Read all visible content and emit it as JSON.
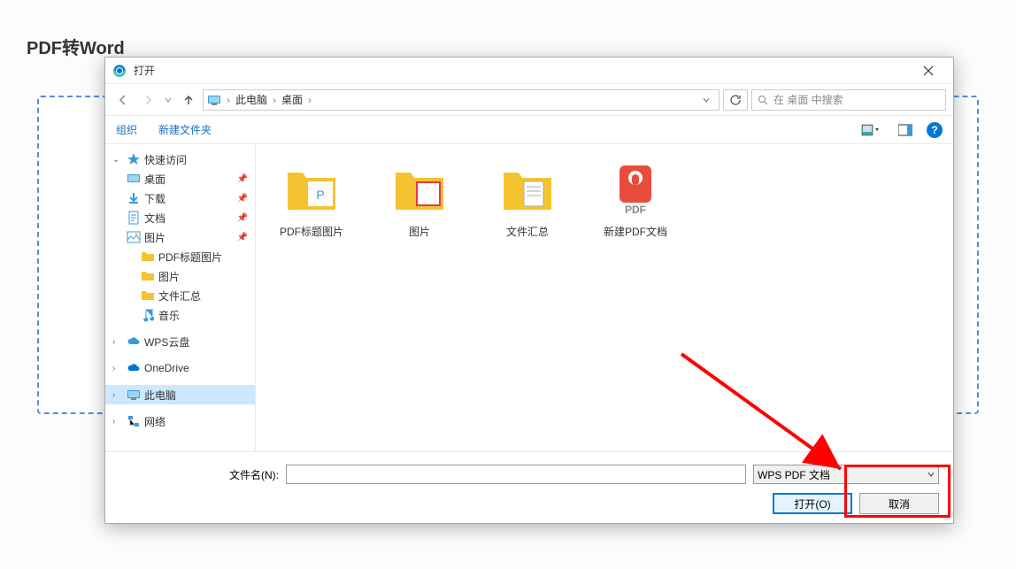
{
  "page": {
    "title": "PDF转Word"
  },
  "dialog": {
    "title": "打开",
    "nav": {
      "crumb1": "此电脑",
      "crumb2": "桌面",
      "search_placeholder": "在 桌面 中搜索"
    },
    "toolbar": {
      "organize": "组织",
      "new_folder": "新建文件夹"
    },
    "sidebar": {
      "quick_access": "快速访问",
      "desktop": "桌面",
      "downloads": "下载",
      "documents": "文档",
      "pictures": "图片",
      "pdf_title_pics": "PDF标题图片",
      "pics": "图片",
      "file_summary": "文件汇总",
      "music": "音乐",
      "wps_cloud": "WPS云盘",
      "onedrive": "OneDrive",
      "this_pc": "此电脑",
      "network": "网络"
    },
    "files": {
      "item1": "PDF标题图片",
      "item2": "图片",
      "item3": "文件汇总",
      "item4": "新建PDF文档"
    },
    "footer": {
      "filename_label": "文件名(N):",
      "filetype": "WPS PDF 文档",
      "open_btn": "打开(O)",
      "cancel_btn": "取消"
    }
  }
}
